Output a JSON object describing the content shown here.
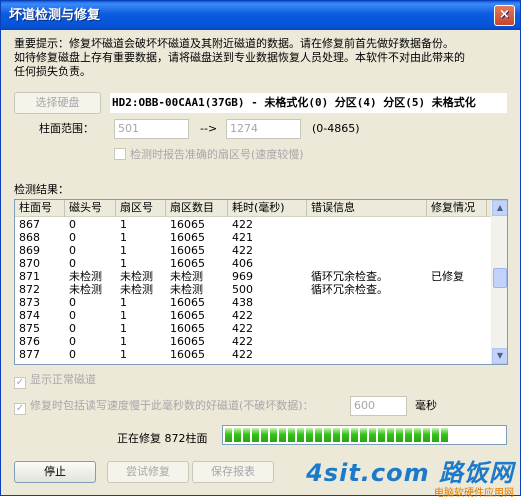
{
  "window": {
    "title": "坏道检测与修复",
    "close": "×"
  },
  "notice": {
    "line1": "重要提示：修复坏磁道会破坏坏磁道及其附近磁道的数据。请在修复前首先做好数据备份。",
    "line2": "如待修复磁盘上存有重要数据，请将磁盘送到专业数据恢复人员处理。本软件不对由此带来的",
    "line3": "任何损失负责。"
  },
  "drive": {
    "button": "选择硬盘",
    "label": "HD2:OBB-00CAA1(37GB) - 未格式化(0) 分区(4) 分区(5) 未格式化"
  },
  "cylinder_range": {
    "label": "柱面范围：",
    "from": "501",
    "arrow": "-->",
    "to": "1274",
    "range_hint": "(0-4865)"
  },
  "options": {
    "accurate_sector_report": "检测时报告准确的扇区号(速度较慢)",
    "show_normal_tracks": "显示正常磁道",
    "include_slow_tracks": "修复时包括读写速度慢于此毫秒数的好磁道(不破坏数据)：",
    "slow_threshold": "600",
    "slow_unit": "毫秒"
  },
  "results": {
    "label": "检测结果：",
    "columns": [
      "柱面号",
      "磁头号",
      "扇区号",
      "扇区数目",
      "耗时(毫秒)",
      "错误信息",
      "修复情况"
    ],
    "rows": [
      [
        "867",
        "0",
        "1",
        "16065",
        "422",
        "",
        ""
      ],
      [
        "868",
        "0",
        "1",
        "16065",
        "421",
        "",
        ""
      ],
      [
        "869",
        "0",
        "1",
        "16065",
        "422",
        "",
        ""
      ],
      [
        "870",
        "0",
        "1",
        "16065",
        "406",
        "",
        ""
      ],
      [
        "871",
        "未检测",
        "未检测",
        "未检测",
        "969",
        "循环冗余检查。",
        "已修复"
      ],
      [
        "872",
        "未检测",
        "未检测",
        "未检测",
        "500",
        "循环冗余检查。",
        ""
      ],
      [
        "873",
        "0",
        "1",
        "16065",
        "438",
        "",
        ""
      ],
      [
        "874",
        "0",
        "1",
        "16065",
        "422",
        "",
        ""
      ],
      [
        "875",
        "0",
        "1",
        "16065",
        "422",
        "",
        ""
      ],
      [
        "876",
        "0",
        "1",
        "16065",
        "422",
        "",
        ""
      ],
      [
        "877",
        "0",
        "1",
        "16065",
        "422",
        "",
        ""
      ]
    ]
  },
  "status": {
    "progress_text": "正在修复 872柱面",
    "progress_fraction": 0.82
  },
  "buttons": {
    "stop": "停止",
    "try_repair": "尝试修复",
    "save_report": "保存报表"
  },
  "watermark": {
    "main": "路饭网",
    "url": "4sit.com",
    "sub": "电脑软硬件应用网"
  },
  "colors": {
    "title_blue": "#0551d6",
    "progress_green": "#38c21a"
  }
}
